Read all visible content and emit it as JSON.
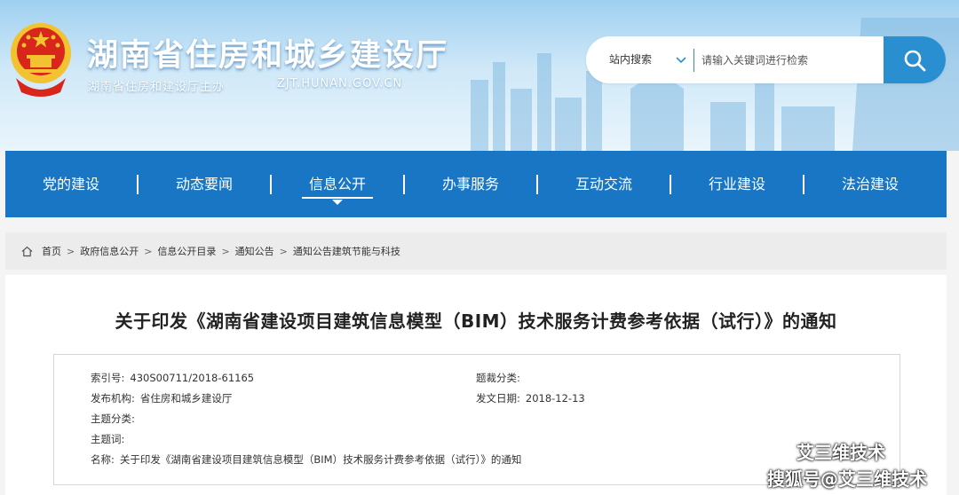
{
  "header": {
    "site_title": "湖南省住房和城乡建设厅",
    "host": "湖南省住房和建设厅主办",
    "url": "ZJT.HUNAN.GOV.CN"
  },
  "search": {
    "scope": "站内搜索",
    "placeholder": "请输入关键词进行检索"
  },
  "nav": {
    "items": [
      {
        "label": "党的建设"
      },
      {
        "label": "动态要闻"
      },
      {
        "label": "信息公开"
      },
      {
        "label": "办事服务"
      },
      {
        "label": "互动交流"
      },
      {
        "label": "行业建设"
      },
      {
        "label": "法治建设"
      }
    ],
    "active_index": 2
  },
  "breadcrumb": {
    "items": [
      "首页",
      "政府信息公开",
      "信息公开目录",
      "通知公告",
      "通知公告建筑节能与科技"
    ],
    "separator": ">"
  },
  "article": {
    "title": "关于印发《湖南省建设项目建筑信息模型（BIM）技术服务计费参考依据（试行）》的通知",
    "meta": {
      "index_label": "索引号:",
      "index_value": "430S00711/2018-61165",
      "category_label": "题裁分类:",
      "category_value": "",
      "publisher_label": "发布机构:",
      "publisher_value": "省住房和城乡建设厅",
      "date_label": "发文日期:",
      "date_value": "2018-12-13",
      "topic_label": "主题分类:",
      "topic_value": "",
      "keywords_label": "主题词:",
      "keywords_value": "",
      "name_label": "名称:",
      "name_value": "关于印发《湖南省建设项目建筑信息模型（BIM）技术服务计费参考依据（试行）》的通知"
    }
  },
  "watermark": {
    "line1": "艾三维技术",
    "line2": "搜狐号@艾三维技术"
  },
  "colors": {
    "nav_bg": "#1976c4",
    "accent": "#2a8fd0",
    "emblem_red": "#d8261b",
    "emblem_gold": "#f2c230"
  }
}
